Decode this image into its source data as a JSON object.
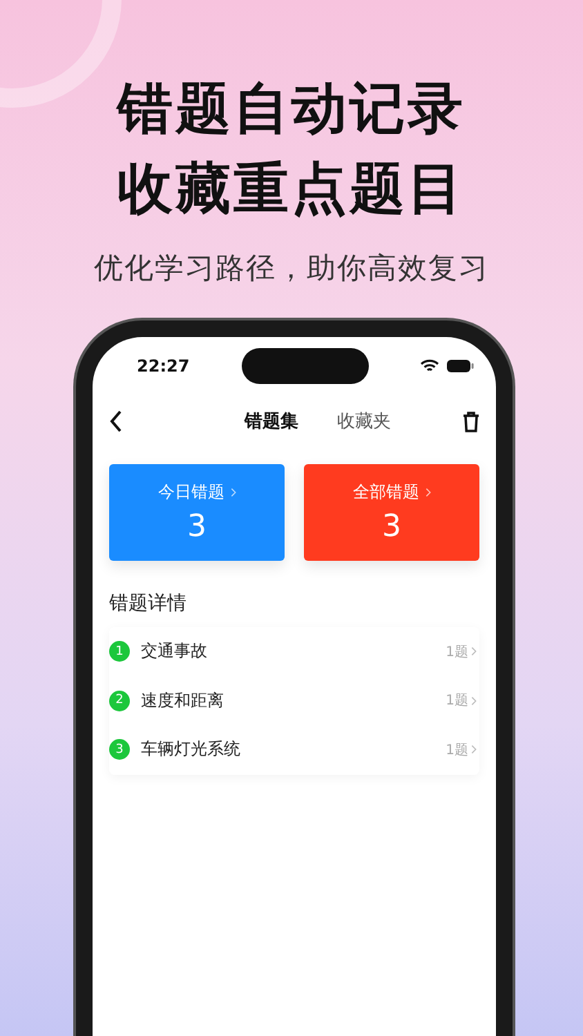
{
  "headline": [
    "错题自动记录",
    "收藏重点题目"
  ],
  "subtitle": "优化学习路径，助你高效复习",
  "status_bar": {
    "time": "22:27"
  },
  "nav": {
    "tabs": [
      {
        "label": "错题集",
        "selected": true
      },
      {
        "label": "收藏夹",
        "selected": false
      }
    ]
  },
  "summary_cards": [
    {
      "label": "今日错题",
      "count": "3",
      "color": "#1a8cff"
    },
    {
      "label": "全部错题",
      "count": "3",
      "color": "#ff3b1f"
    }
  ],
  "section_title": "错题详情",
  "items": [
    {
      "index": "1",
      "name": "交通事故",
      "count": "1题"
    },
    {
      "index": "2",
      "name": "速度和距离",
      "count": "1题"
    },
    {
      "index": "3",
      "name": "车辆灯光系统",
      "count": "1题"
    }
  ]
}
